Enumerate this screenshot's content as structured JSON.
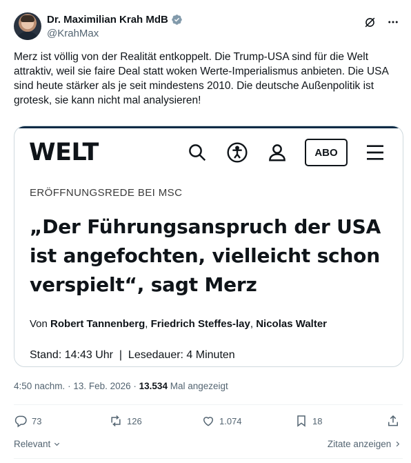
{
  "author": {
    "display_name": "Dr. Maximilian Krah MdB",
    "handle": "@KrahMax"
  },
  "tweet": {
    "text": "Merz ist völlig von der Realität entkoppelt. Die Trump-USA sind für die Welt attraktiv, weil sie faire Deal statt woken Werte-Imperialismus anbieten. Die USA sind heute stärker als je seit mindestens 2010. Die deutsche Außenpolitik ist grotesk, sie kann nicht mal analysieren!"
  },
  "card": {
    "logo": "WELT",
    "abo_label": "ABO",
    "kicker": "ERÖFFNUNGSREDE BEI MSC",
    "headline": "„Der Führungsanspruch der USA ist angefochten, vielleicht schon verspielt“, sagt Merz",
    "authors_prefix": "Von",
    "author_1": "Robert Tannenberg",
    "author_2": "Friedrich Steffes-lay",
    "author_3": "Nicolas Walter",
    "stand": "Stand: 14:43 Uhr",
    "read_time": "Lesedauer: 4 Minuten"
  },
  "meta": {
    "time": "4:50 nachm.",
    "date": "13. Feb. 2026",
    "views": "13.534",
    "views_label": "Mal angezeigt"
  },
  "actions": {
    "replies": "73",
    "reposts": "126",
    "likes": "1.074",
    "bookmarks": "18"
  },
  "footer": {
    "sort_label": "Relevant",
    "quotes_label": "Zitate anzeigen"
  },
  "colors": {
    "verified": "#829aab",
    "secondary_text": "#536471",
    "border": "#cfd9de"
  },
  "icons": [
    "verified-badge-icon",
    "grok-slash-icon",
    "more-icon",
    "search-icon",
    "accessibility-icon",
    "user-icon",
    "menu-icon",
    "reply-icon",
    "repost-icon",
    "like-icon",
    "bookmark-icon",
    "share-icon",
    "chevron-down-icon",
    "chevron-right-icon"
  ]
}
